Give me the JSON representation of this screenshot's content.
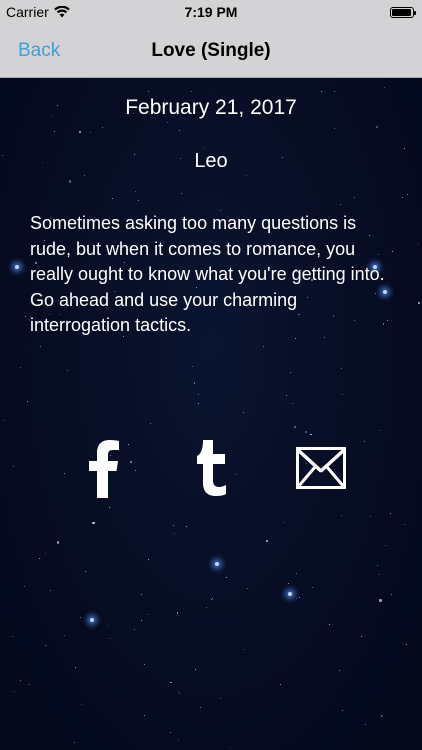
{
  "status_bar": {
    "carrier": "Carrier",
    "time": "7:19 PM"
  },
  "nav": {
    "back_label": "Back",
    "title": "Love (Single)"
  },
  "content": {
    "date": "February 21, 2017",
    "sign": "Leo",
    "horoscope": "Sometimes asking too many questions is rude, but when it comes to romance, you really ought to know what you're getting into. Go ahead and use your charming interrogation tactics."
  },
  "share": {
    "icons": [
      "facebook-icon",
      "tumblr-icon",
      "mail-icon"
    ]
  },
  "colors": {
    "nav_background": "#d3d3d6",
    "back_accent": "#3f9fd9",
    "sky_background": "#050b1e",
    "text": "#ffffff"
  }
}
